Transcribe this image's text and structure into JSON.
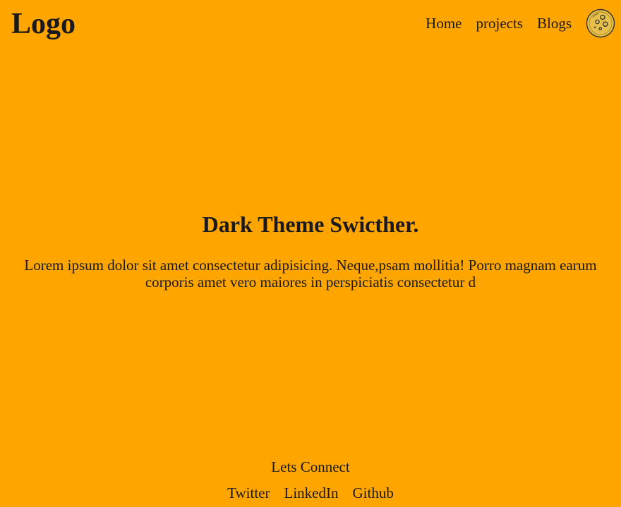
{
  "header": {
    "logo": "Logo",
    "nav": [
      "Home",
      "projects",
      "Blogs"
    ],
    "theme_icon": "moon-icon"
  },
  "hero": {
    "title": "Dark Theme Swicther.",
    "text": "Lorem ipsum dolor sit amet consectetur adipisicing. Neque,psam mollitia! Porro magnam earum corporis amet vero maiores in perspiciatis consectetur d"
  },
  "footer": {
    "title": "Lets Connect",
    "links": [
      "Twitter",
      "LinkedIn",
      "Github"
    ]
  },
  "colors": {
    "background": "#ffa500",
    "text": "#1a1a1a",
    "moon_fill": "#e6c04a",
    "moon_stroke": "#333333"
  }
}
